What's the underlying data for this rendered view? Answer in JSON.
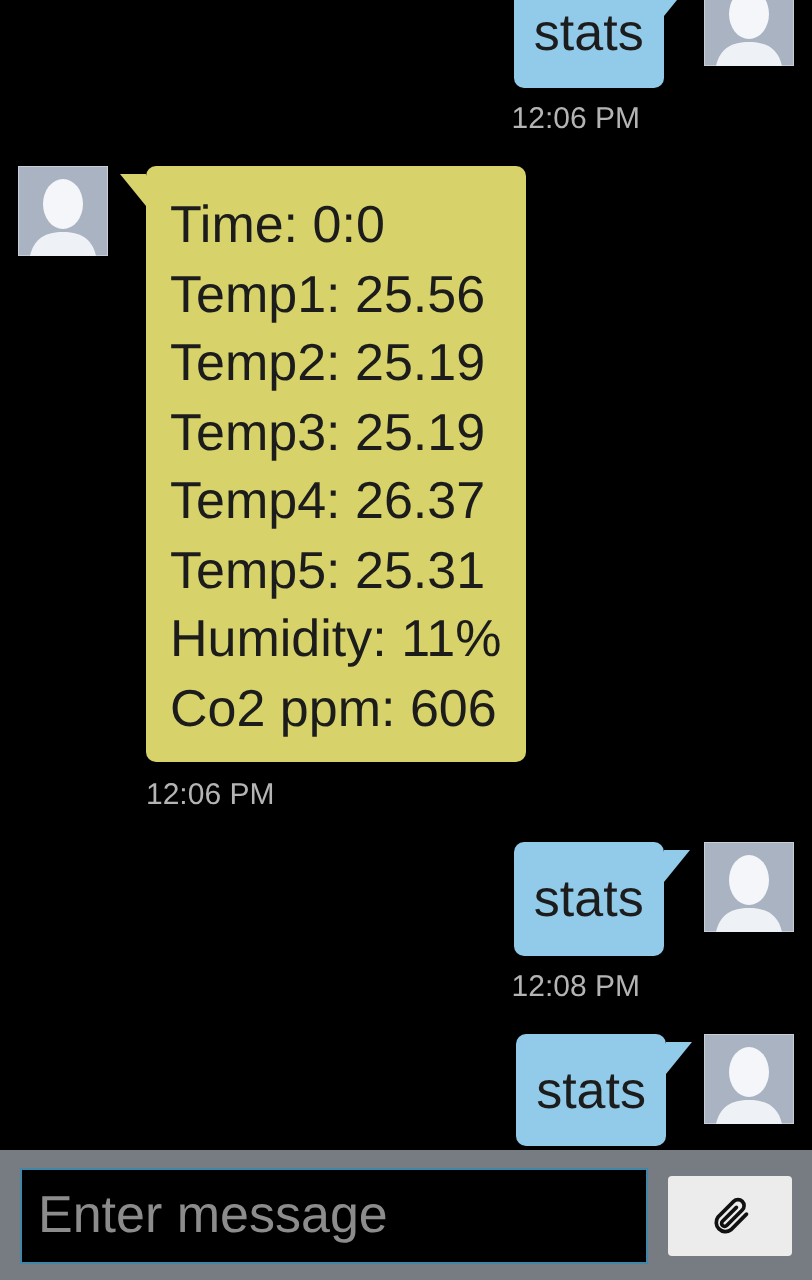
{
  "messages": [
    {
      "kind": "sent",
      "lines": [
        "stats"
      ],
      "time": "12:06 PM"
    },
    {
      "kind": "received",
      "lines": [
        "Time: 0:0",
        "Temp1: 25.56",
        "Temp2: 25.19",
        "Temp3: 25.19",
        "Temp4: 26.37",
        "Temp5: 25.31",
        "Humidity: 11%",
        "Co2 ppm: 606"
      ],
      "time": "12:06 PM"
    },
    {
      "kind": "sent",
      "lines": [
        "stats"
      ],
      "time": "12:08 PM"
    },
    {
      "kind": "sent",
      "lines": [
        "stats"
      ]
    }
  ],
  "composer": {
    "placeholder": "Enter message"
  }
}
